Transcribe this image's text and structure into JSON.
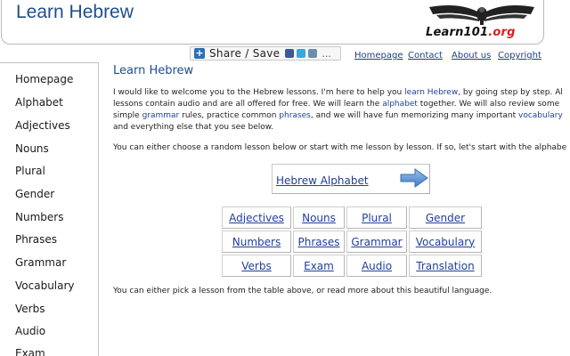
{
  "header": {
    "site_title": "Learn Hebrew",
    "logo_text": "Learn101",
    "logo_suffix": ".org"
  },
  "share": {
    "label": "Share / Save",
    "more": "..."
  },
  "top_nav": [
    "Homepage",
    "Contact",
    "About us",
    "Copyright"
  ],
  "sidebar": {
    "items": [
      "Homepage",
      "Alphabet",
      "Adjectives",
      "Nouns",
      "Plural",
      "Gender",
      "Numbers",
      "Phrases",
      "Grammar",
      "Vocabulary",
      "Verbs",
      "Audio",
      "Exam"
    ]
  },
  "main": {
    "title": "Learn Hebrew",
    "intro": {
      "l1a": "I would like to welcome you to the Hebrew lessons. I'm here to help you ",
      "l1b": "learn Hebrew",
      "l1c": ", by going step by step. Al",
      "l2a": "lessons contain audio and are all offered for free. We will learn the ",
      "l2b": "alphabet",
      "l2c": " together. We will also review some",
      "l3a": "simple ",
      "l3b": "grammar",
      "l3c": " rules, practice common ",
      "l3d": "phrases",
      "l3e": ", and we will have fun memorizing many important ",
      "l3f": "vocabulary",
      "l4": "and everything else that you see below."
    },
    "para2": "You can either choose a random lesson below or start with me lesson by lesson. If so, let's start with the alphabe",
    "alphabet_button": "Hebrew Alphabet",
    "lessons": [
      [
        "Adjectives",
        "Nouns",
        "Plural",
        "Gender"
      ],
      [
        "Numbers",
        "Phrases",
        "Grammar",
        "Vocabulary"
      ],
      [
        "Verbs",
        "Exam",
        "Audio",
        "Translation"
      ]
    ],
    "outro": "You can either pick a lesson from the table above, or read more about this beautiful language."
  }
}
